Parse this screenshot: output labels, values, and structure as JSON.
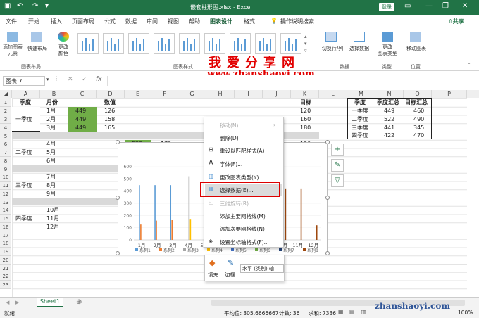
{
  "titlebar": {
    "title": "嵌套柱形图.xlsx - Excel",
    "login": "登录",
    "share": "共享"
  },
  "tabs": [
    "文件",
    "开始",
    "插入",
    "页面布局",
    "公式",
    "数据",
    "审阅",
    "视图",
    "帮助",
    "图表设计",
    "格式"
  ],
  "tell_me": "操作说明搜索",
  "ribbon": {
    "add_element": "添加图表\n元素",
    "quick_layout": "快速布局",
    "change_colors": "更改\n颜色",
    "group_layout": "图表布局",
    "group_styles": "图表样式",
    "switch_rowcol": "切换行/列",
    "select_data": "选择数据",
    "group_data": "数据",
    "change_type": "更改\n图表类型",
    "group_type": "类型",
    "move_chart": "移动图表",
    "group_location": "位置"
  },
  "watermark": {
    "line1": "我爱分享网",
    "line2": "www.zhanshaoyi.com",
    "corner": "zhanshaoyi.com"
  },
  "formula_bar": {
    "name_box": "图表 7",
    "fx": "fx"
  },
  "columns": [
    "A",
    "B",
    "C",
    "D",
    "E",
    "F",
    "G",
    "H",
    "I",
    "J",
    "K",
    "L",
    "M",
    "N",
    "O",
    "P"
  ],
  "rows": [
    "1",
    "2",
    "3",
    "4",
    "5",
    "6",
    "7",
    "8",
    "9",
    "10",
    "11",
    "12",
    "13",
    "14",
    "15",
    "16",
    "17",
    "18",
    "19",
    "20",
    "21",
    "22",
    "23"
  ],
  "table": {
    "headers": {
      "season": "季度",
      "month": "月份",
      "value": "数值",
      "target": "目标"
    },
    "q1": "一季度",
    "q2": "二季度",
    "q3": "三季度",
    "q4": "四季度",
    "months": [
      "1月",
      "2月",
      "3月",
      "4月",
      "5月",
      "6月",
      "7月",
      "8月",
      "9月",
      "10月",
      "11月",
      "12月"
    ],
    "c_values": [
      "449",
      "449",
      "449"
    ],
    "d_values": [
      "126",
      "158",
      "165"
    ],
    "k_values": [
      "120",
      "160",
      "180",
      "120"
    ],
    "e6": "522",
    "f6": "172"
  },
  "summary": {
    "headers": [
      "季度",
      "季度汇总",
      "目标汇总"
    ],
    "rows": [
      [
        "一季度",
        "449",
        "460"
      ],
      [
        "二季度",
        "522",
        "490"
      ],
      [
        "三季度",
        "441",
        "345"
      ],
      [
        "四季度",
        "422",
        "470"
      ]
    ]
  },
  "chart_data": {
    "type": "bar",
    "categories": [
      "1月",
      "2月",
      "3月",
      "4月",
      "5月",
      "6月",
      "7月",
      "8月",
      "9月",
      "10月",
      "11月",
      "12月"
    ],
    "yticks": [
      "0",
      "100",
      "200",
      "300",
      "400",
      "500",
      "600"
    ],
    "ylim": [
      0,
      600
    ],
    "legend": [
      "系列1",
      "系列2",
      "系列3",
      "系列4",
      "系列5",
      "系列6",
      "系列7",
      "系列8"
    ],
    "series": [
      {
        "name": "系列1",
        "color": "#5b9bd5",
        "values": [
          449,
          449,
          449,
          0,
          0,
          0,
          0,
          0,
          0,
          0,
          0,
          0
        ]
      },
      {
        "name": "系列2",
        "color": "#ed7d31",
        "values": [
          126,
          158,
          165,
          0,
          0,
          0,
          0,
          0,
          0,
          0,
          0,
          0
        ]
      },
      {
        "name": "系列3",
        "color": "#a5a5a5",
        "values": [
          0,
          0,
          0,
          522,
          522,
          522,
          0,
          0,
          0,
          0,
          0,
          0
        ]
      },
      {
        "name": "系列4",
        "color": "#ffc000",
        "values": [
          0,
          0,
          0,
          172,
          165,
          0,
          0,
          0,
          0,
          0,
          0,
          0
        ]
      },
      {
        "name": "系列8",
        "color": "#9e480e",
        "values": [
          0,
          0,
          0,
          0,
          0,
          0,
          0,
          0,
          0,
          422,
          422,
          120
        ]
      }
    ]
  },
  "context_menu": {
    "items": [
      {
        "label": "移动(N)",
        "disabled": true
      },
      {
        "label": "删除(D)",
        "disabled": false
      },
      {
        "label": "重设以匹配样式(A)",
        "disabled": false
      },
      {
        "label": "字体(F)...",
        "disabled": false
      },
      {
        "label": "更改图表类型(Y)...",
        "disabled": false
      },
      {
        "label": "选择数据(E)...",
        "disabled": false
      },
      {
        "label": "三维旋转(R)...",
        "disabled": true
      },
      {
        "label": "添加主要网格线(M)",
        "disabled": false
      },
      {
        "label": "添加次要网格线(N)",
        "disabled": false
      },
      {
        "label": "设置坐标轴格式(F)...",
        "disabled": false
      }
    ]
  },
  "minibar": {
    "fill": "填充",
    "border": "边框",
    "axis_select": "水平 (类别) 轴"
  },
  "sheet": {
    "name": "Sheet1"
  },
  "status": {
    "left": "就绪",
    "average": "平均值: 305.6666667",
    "count": "计数: 36",
    "sum": "求和: 7336",
    "zoom": "100%"
  }
}
